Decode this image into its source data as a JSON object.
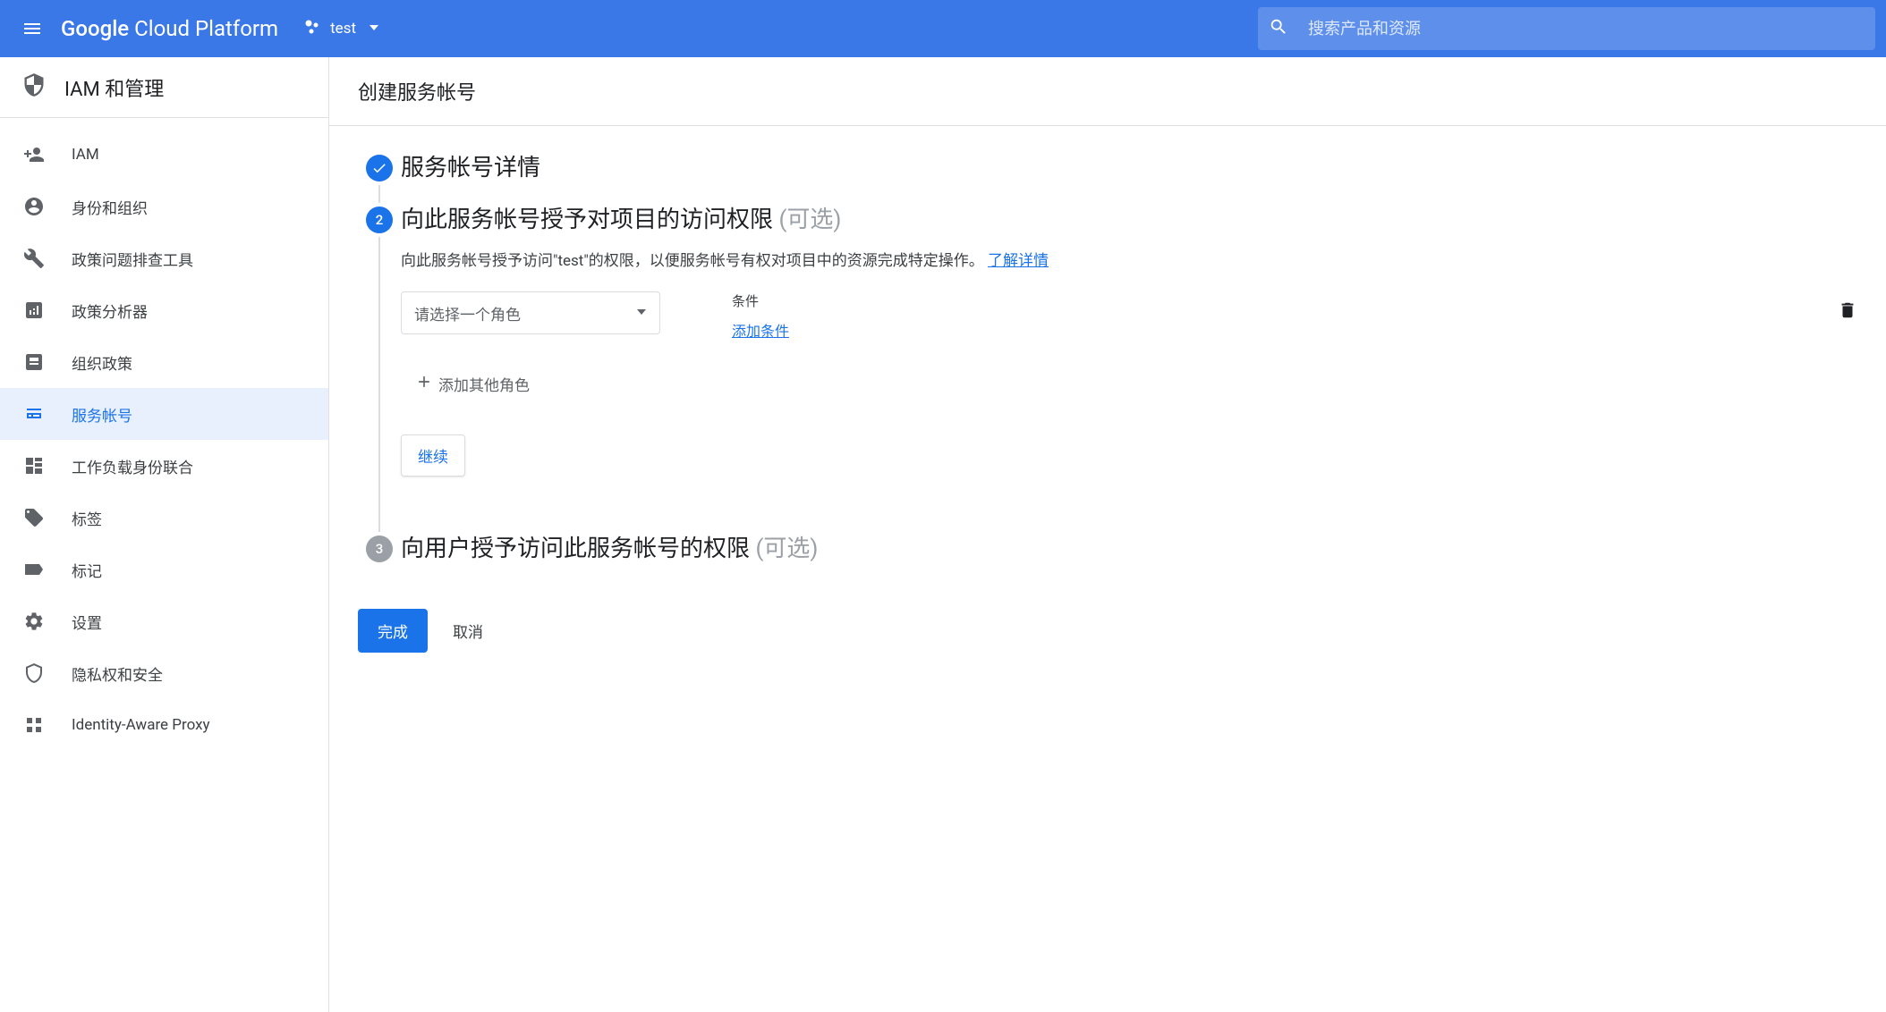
{
  "header": {
    "logo_prefix": "Google",
    "logo_suffix": " Cloud Platform",
    "project_name": "test",
    "search_placeholder": "搜索产品和资源"
  },
  "sidebar": {
    "section_title": "IAM 和管理",
    "items": [
      {
        "label": "IAM",
        "icon": "iam"
      },
      {
        "label": "身份和组织",
        "icon": "person"
      },
      {
        "label": "政策问题排查工具",
        "icon": "wrench"
      },
      {
        "label": "政策分析器",
        "icon": "analyzer"
      },
      {
        "label": "组织政策",
        "icon": "org-policy"
      },
      {
        "label": "服务帐号",
        "icon": "service-account"
      },
      {
        "label": "工作负载身份联合",
        "icon": "workload"
      },
      {
        "label": "标签",
        "icon": "tag"
      },
      {
        "label": "标记",
        "icon": "mark"
      },
      {
        "label": "设置",
        "icon": "gear"
      },
      {
        "label": "隐私权和安全",
        "icon": "shield"
      },
      {
        "label": "Identity-Aware Proxy",
        "icon": "proxy"
      }
    ]
  },
  "main": {
    "page_title": "创建服务帐号",
    "step1": {
      "title": "服务帐号详情"
    },
    "step2": {
      "title": "向此服务帐号授予对项目的访问权限",
      "optional": "(可选)",
      "description_prefix": "向此服务帐号授予访问\"test\"的权限，以便服务帐号有权对项目中的资源完成特定操作。",
      "learn_more": "了解详情",
      "role_placeholder": "请选择一个角色",
      "condition_label": "条件",
      "add_condition": "添加条件",
      "add_role": "添加其他角色",
      "continue": "继续"
    },
    "step3": {
      "title": "向用户授予访问此服务帐号的权限",
      "optional": "(可选)",
      "number": "3"
    },
    "step2_number": "2",
    "done": "完成",
    "cancel": "取消"
  }
}
